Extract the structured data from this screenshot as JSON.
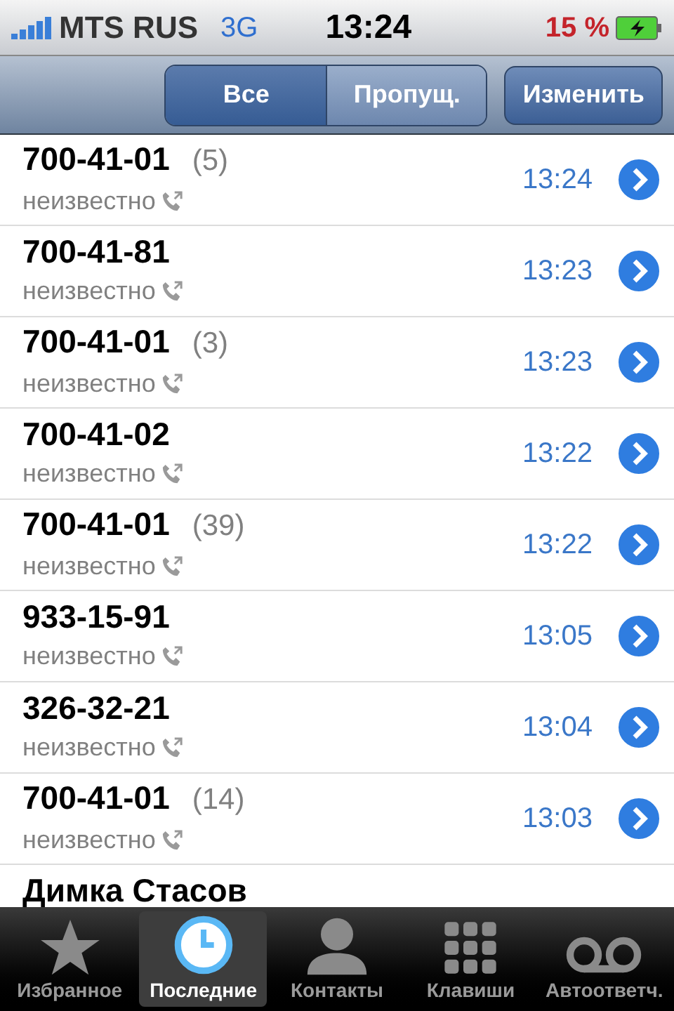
{
  "status_bar": {
    "carrier": "MTS RUS",
    "network": "3G",
    "time": "13:24",
    "battery_percent": "15 %",
    "charging": true
  },
  "nav_bar": {
    "segments": [
      {
        "label": "Все",
        "selected": true
      },
      {
        "label": "Пропущ.",
        "selected": false
      }
    ],
    "edit_button": "Изменить"
  },
  "calls": [
    {
      "number": "700-41-01",
      "count": "(5)",
      "label": "неизвестно",
      "time": "13:24"
    },
    {
      "number": "700-41-81",
      "label": "неизвестно",
      "time": "13:23"
    },
    {
      "number": "700-41-01",
      "count": "(3)",
      "label": "неизвестно",
      "time": "13:23"
    },
    {
      "number": "700-41-02",
      "label": "неизвестно",
      "time": "13:22"
    },
    {
      "number": "700-41-01",
      "count": "(39)",
      "label": "неизвестно",
      "time": "13:22"
    },
    {
      "number": "933-15-91",
      "label": "неизвестно",
      "time": "13:05"
    },
    {
      "number": "326-32-21",
      "label": "неизвестно",
      "time": "13:04"
    },
    {
      "number": "700-41-01",
      "count": "(14)",
      "label": "неизвестно",
      "time": "13:03"
    },
    {
      "number": "Димка Стасов"
    }
  ],
  "tab_bar": [
    {
      "kind": "star",
      "label": "Избранное",
      "selected": false
    },
    {
      "kind": "clock",
      "label": "Последние",
      "selected": true
    },
    {
      "kind": "person",
      "label": "Контакты",
      "selected": false
    },
    {
      "kind": "keypad",
      "label": "Клавиши",
      "selected": false
    },
    {
      "kind": "voicemail",
      "label": "Автоответч.",
      "selected": false
    }
  ]
}
